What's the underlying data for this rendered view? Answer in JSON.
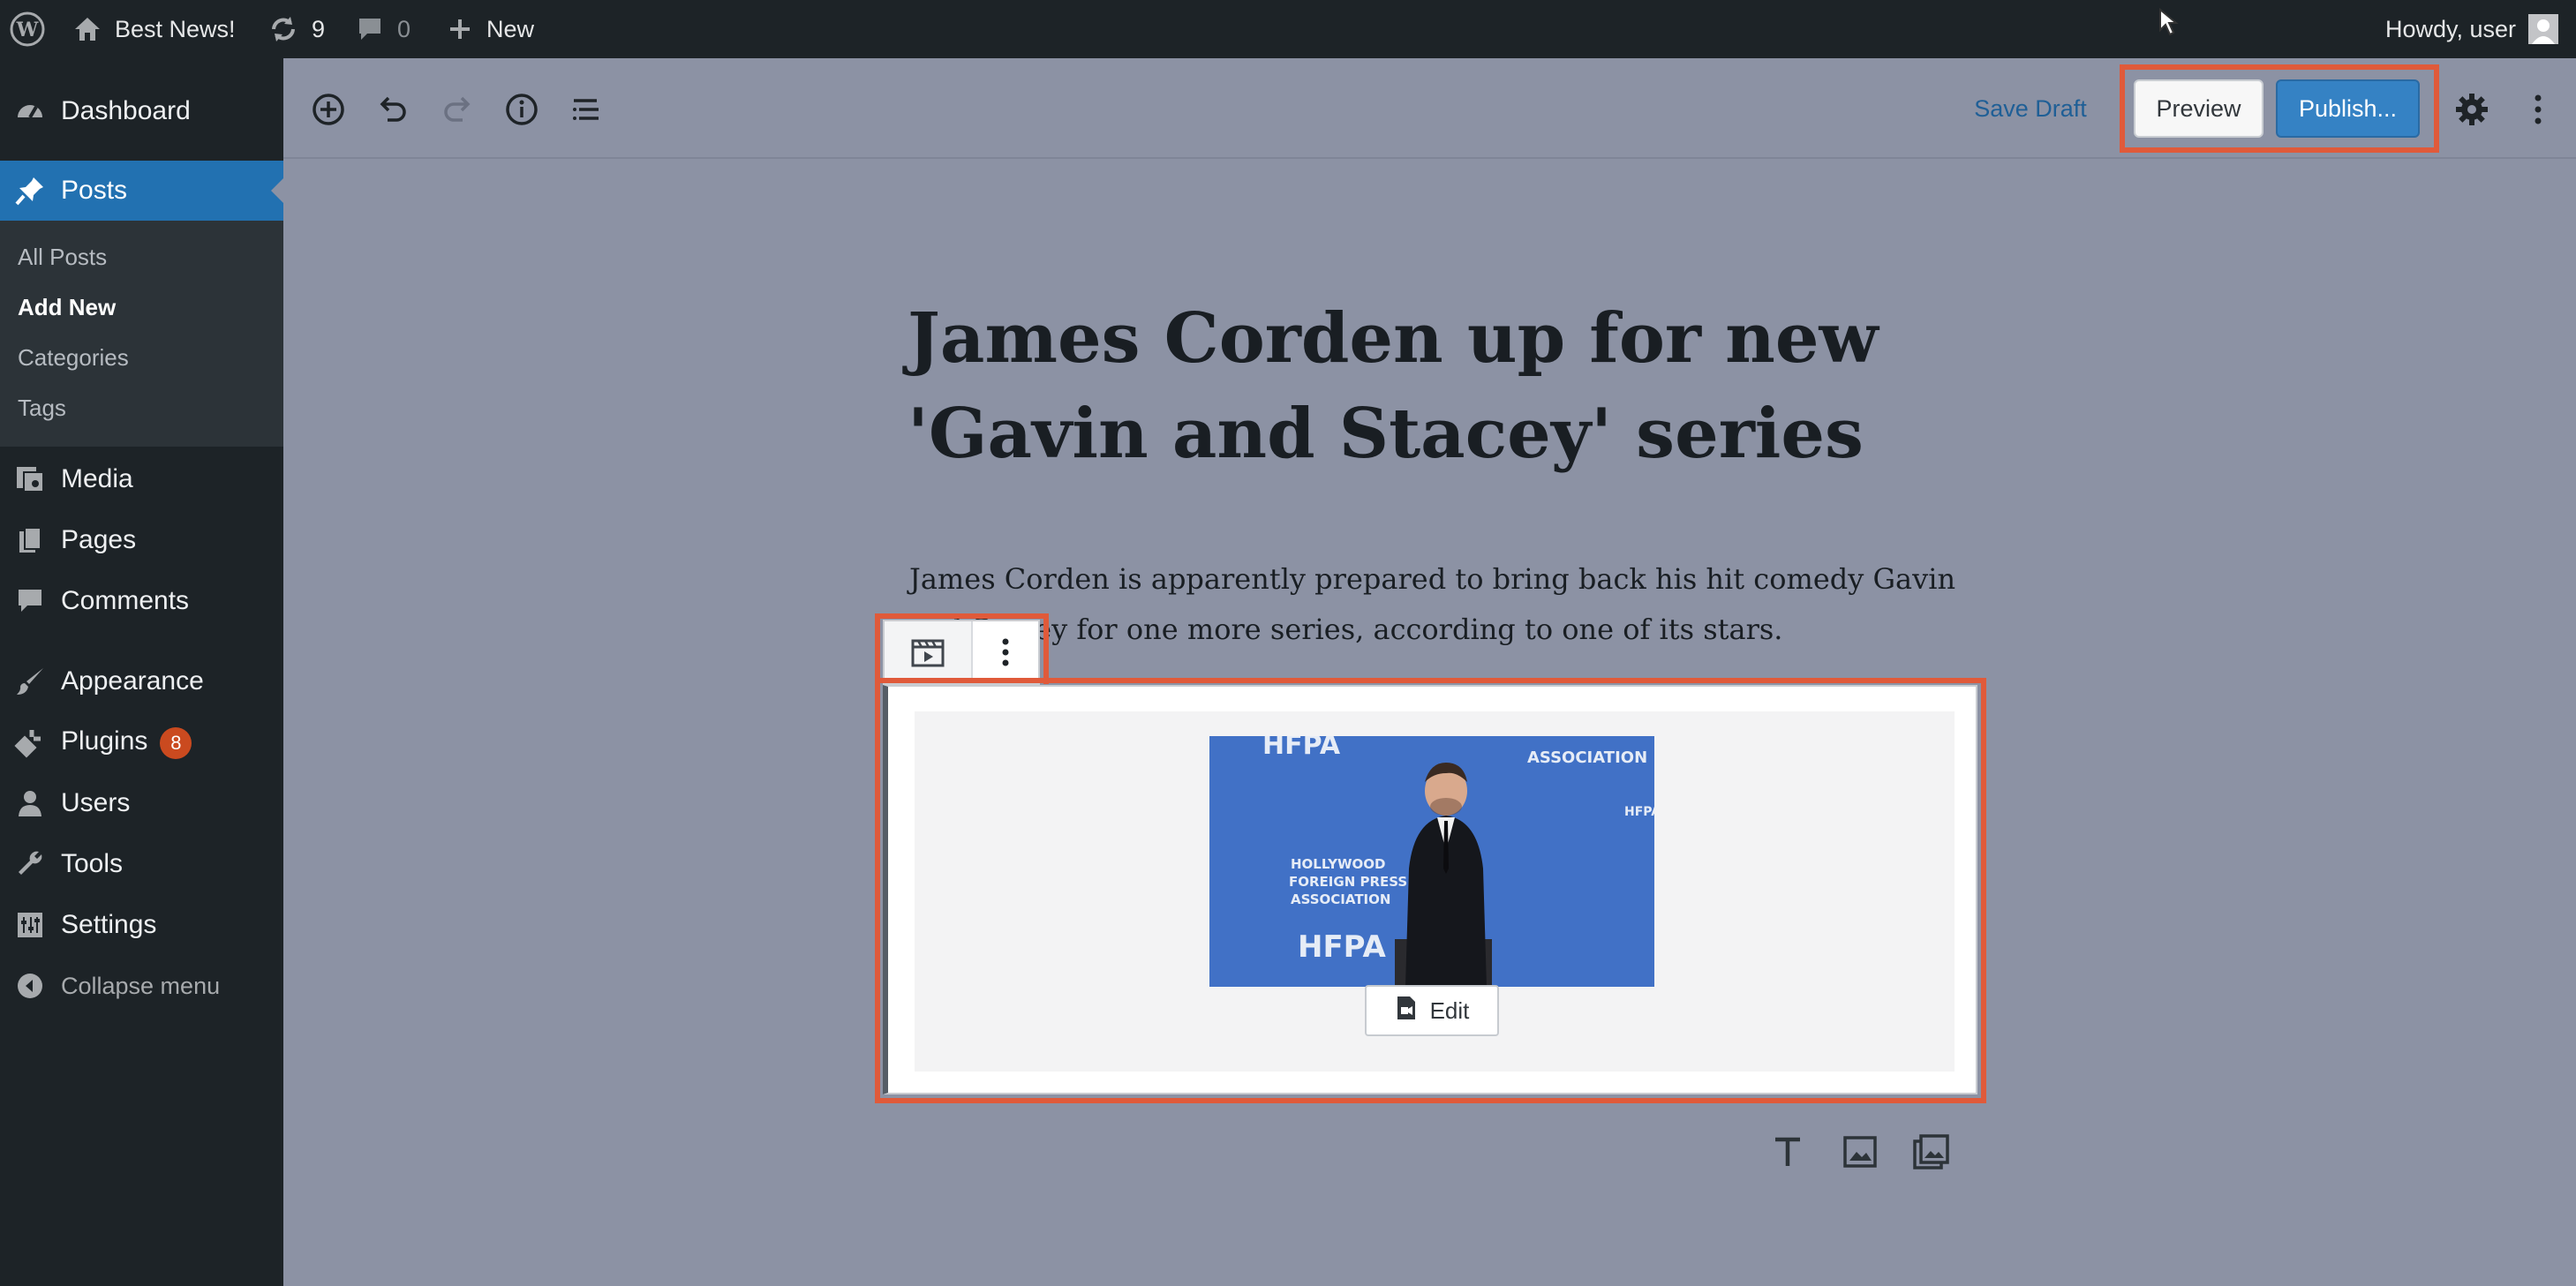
{
  "adminbar": {
    "site_name": "Best News!",
    "updates_count": "9",
    "comments_count": "0",
    "new_label": "New",
    "howdy": "Howdy, user"
  },
  "sidebar": {
    "dashboard": "Dashboard",
    "posts": "Posts",
    "submenu": [
      "All Posts",
      "Add New",
      "Categories",
      "Tags"
    ],
    "media": "Media",
    "pages": "Pages",
    "comments": "Comments",
    "appearance": "Appearance",
    "plugins": "Plugins",
    "plugins_badge": "8",
    "users": "Users",
    "tools": "Tools",
    "settings": "Settings",
    "collapse": "Collapse menu"
  },
  "toolbar": {
    "save_draft": "Save Draft",
    "preview": "Preview",
    "publish": "Publish..."
  },
  "post": {
    "title_line1": "James Corden up for new",
    "title_line2": "'Gavin and Stacey' series",
    "para_line1": "James Corden is apparently prepared to bring back his hit comedy Gavin",
    "para_line2": "and Stacey for one more series, according to one of its stars."
  },
  "video_block": {
    "edit_label": "Edit",
    "poster_text": [
      "HFPA",
      "HOLLYWOOD",
      "FOREIGN PRESS",
      "ASSOCIATION"
    ]
  },
  "colors": {
    "admin_bg": "#1d2327",
    "accent_blue": "#2271b1",
    "publish_blue": "#3582c4",
    "highlight": "#e05a3a",
    "editor_overlay": "#8c92a4"
  }
}
